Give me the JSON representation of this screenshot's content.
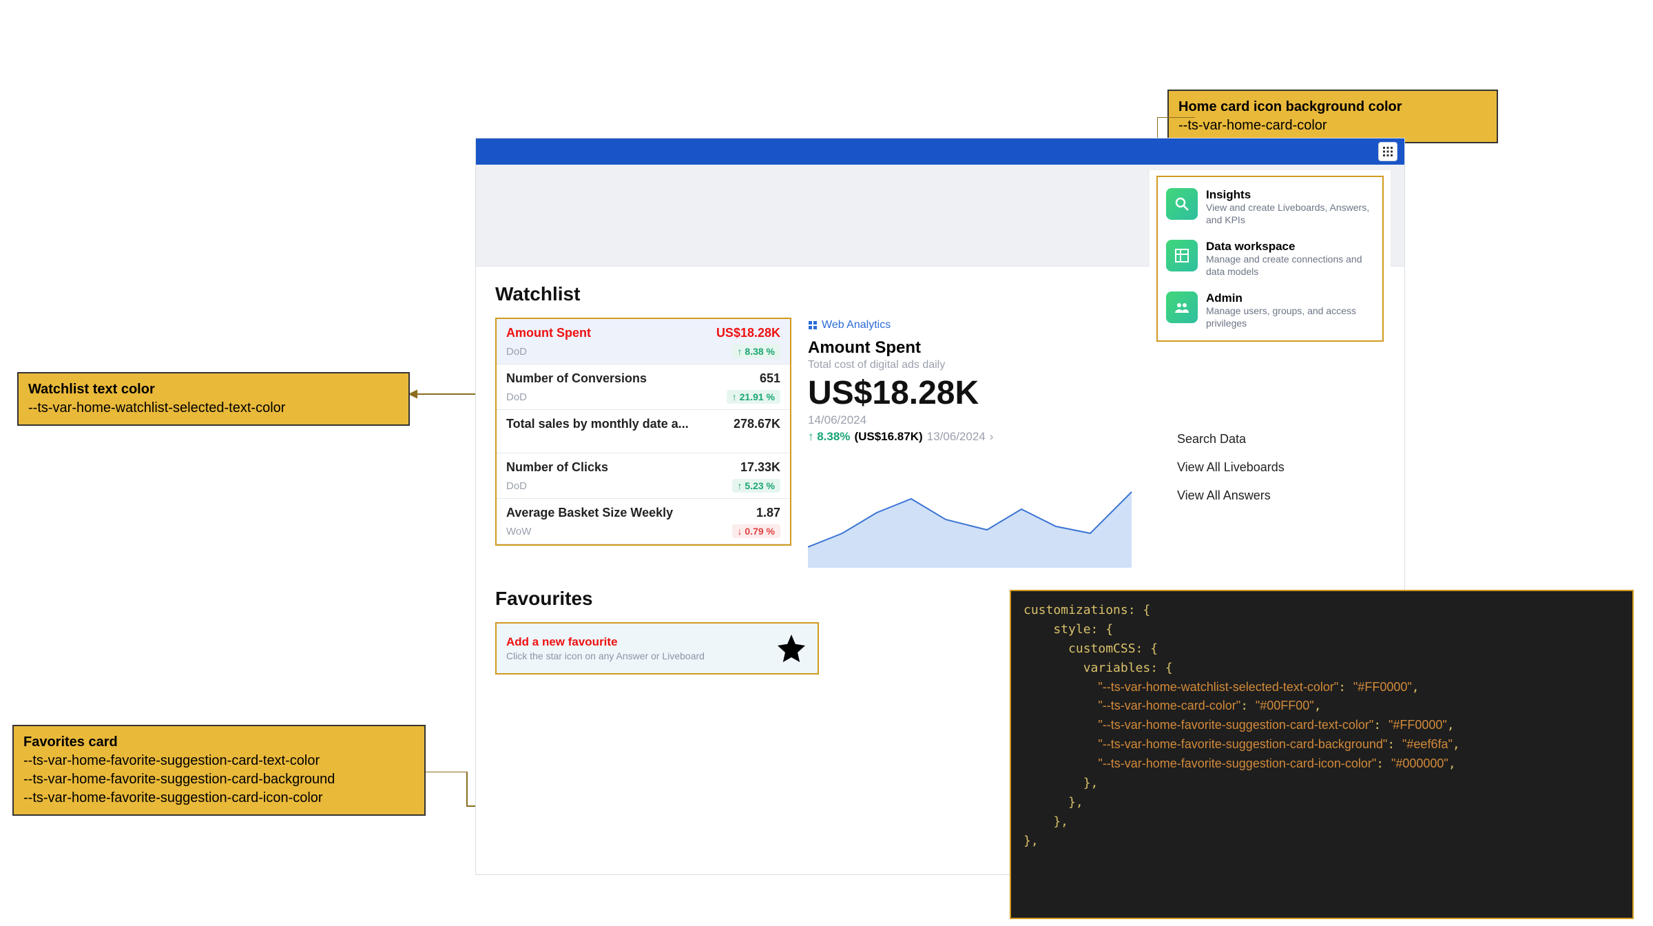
{
  "callouts": {
    "homecard": {
      "title": "Home card icon background color",
      "sub": "--ts-var-home-card-color"
    },
    "watchlist": {
      "title": "Watchlist text color",
      "sub": "--ts-var-home-watchlist-selected-text-color"
    },
    "favorites": {
      "title": "Favorites card",
      "sub1": "--ts-var-home-favorite-suggestion-card-text-color",
      "sub2": "--ts-var-home-favorite-suggestion-card-background",
      "sub3": "--ts-var-home-favorite-suggestion-card-icon-color"
    }
  },
  "sections": {
    "watchlist": "Watchlist",
    "favourites": "Favourites"
  },
  "watchlist": [
    {
      "name": "Amount Spent",
      "value": "US$18.28K",
      "period": "DoD",
      "delta": "8.38 %",
      "dir": "up",
      "selected": true
    },
    {
      "name": "Number of Conversions",
      "value": "651",
      "period": "DoD",
      "delta": "21.91 %",
      "dir": "up",
      "selected": false
    },
    {
      "name": "Total sales by monthly date a...",
      "value": "278.67K",
      "period": "",
      "delta": "",
      "dir": "",
      "selected": false
    },
    {
      "name": "Number of Clicks",
      "value": "17.33K",
      "period": "DoD",
      "delta": "5.23 %",
      "dir": "up",
      "selected": false
    },
    {
      "name": "Average Basket Size Weekly",
      "value": "1.87",
      "period": "WoW",
      "delta": "0.79 %",
      "dir": "down",
      "selected": false
    }
  ],
  "detail": {
    "crumb": "Web Analytics",
    "title": "Amount Spent",
    "subtitle": "Total cost of digital ads daily",
    "value": "US$18.28K",
    "date": "14/06/2024",
    "delta": "↑ 8.38%",
    "prev": "(US$16.87K)",
    "prevdate": "13/06/2024"
  },
  "cards": [
    {
      "title": "Insights",
      "desc": "View and create Liveboards, Answers, and KPIs",
      "icon": "search"
    },
    {
      "title": "Data workspace",
      "desc": "Manage and create connections and data models",
      "icon": "grid"
    },
    {
      "title": "Admin",
      "desc": "Manage users, groups, and access privileges",
      "icon": "users"
    }
  ],
  "quicklinks": [
    "Search Data",
    "View All Liveboards",
    "View All Answers"
  ],
  "favorite": {
    "title": "Add a new favourite",
    "desc": "Click the star icon on any Answer or Liveboard"
  },
  "code": "customizations: {\n    style: {\n      customCSS: {\n        variables: {\n          \"--ts-var-home-watchlist-selected-text-color\": \"#FF0000\",\n          \"--ts-var-home-card-color\": \"#00FF00\",\n          \"--ts-var-home-favorite-suggestion-card-text-color\": \"#FF0000\",\n          \"--ts-var-home-favorite-suggestion-card-background\": \"#eef6fa\",\n          \"--ts-var-home-favorite-suggestion-card-icon-color\": \"#000000\",\n        },\n      },\n    },\n},"
}
